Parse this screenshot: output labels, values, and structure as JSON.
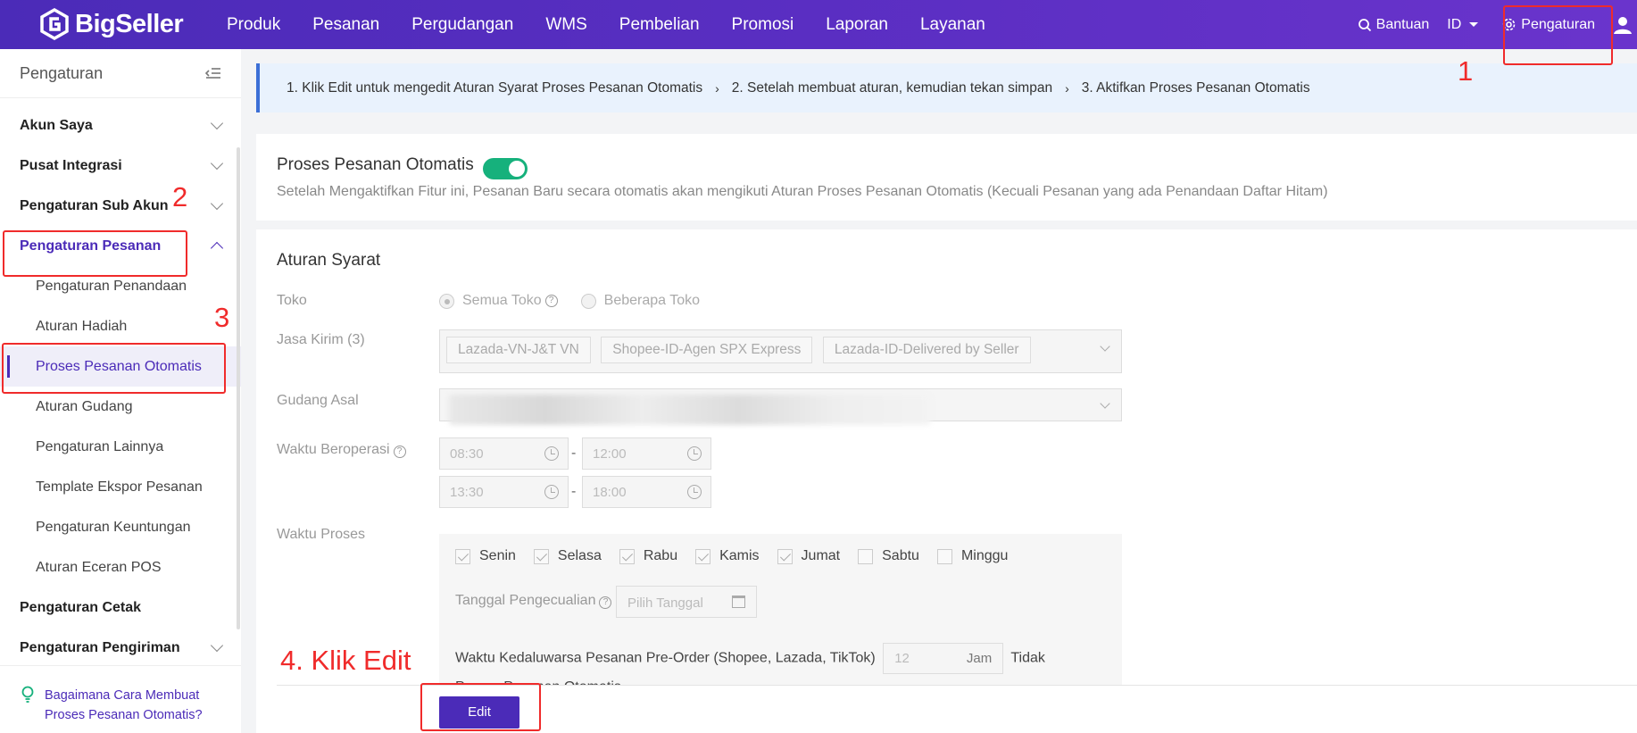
{
  "app": {
    "name": "BigSeller"
  },
  "nav": [
    "Produk",
    "Pesanan",
    "Pergudangan",
    "WMS",
    "Pembelian",
    "Promosi",
    "Laporan",
    "Layanan"
  ],
  "top_right": {
    "help": "Bantuan",
    "lang": "ID",
    "settings": "Pengaturan"
  },
  "sidebar": {
    "title": "Pengaturan",
    "groups": {
      "akun": "Akun Saya",
      "integrasi": "Pusat Integrasi",
      "sub_akun": "Pengaturan Sub Akun",
      "pesanan": "Pengaturan Pesanan",
      "cetak": "Pengaturan Cetak",
      "pengiriman": "Pengaturan Pengiriman"
    },
    "sub_items": [
      "Pengaturan Penandaan",
      "Aturan Hadiah",
      "Proses Pesanan Otomatis",
      "Aturan Gudang",
      "Pengaturan Lainnya",
      "Template Ekspor Pesanan",
      "Pengaturan Keuntungan",
      "Aturan Eceran POS"
    ],
    "help_link": "Bagaimana Cara Membuat Proses Pesanan Otomatis?"
  },
  "banner": {
    "step1": "1. Klik Edit untuk mengedit Aturan Syarat Proses Pesanan Otomatis",
    "step2": "2. Setelah membuat aturan, kemudian tekan simpan",
    "step3": "3. Aktifkan Proses Pesanan Otomatis"
  },
  "auto_process": {
    "title": "Proses Pesanan Otomatis",
    "enabled": true,
    "description": "Setelah Mengaktifkan Fitur ini, Pesanan Baru secara otomatis akan mengikuti Aturan Proses Pesanan Otomatis (Kecuali Pesanan yang ada Penandaan Daftar Hitam)"
  },
  "rules": {
    "title": "Aturan Syarat",
    "toko_label": "Toko",
    "toko_options": [
      "Semua Toko",
      "Beberapa Toko"
    ],
    "toko_selected": "Semua Toko",
    "jasa_label": "Jasa Kirim (3)",
    "jasa_tags": [
      "Lazada-VN-J&T VN",
      "Shopee-ID-Agen SPX Express",
      "Lazada-ID-Delivered by Seller"
    ],
    "gudang_label": "Gudang Asal",
    "waktu_label": "Waktu Beroperasi",
    "times": [
      [
        "08:30",
        "12:00"
      ],
      [
        "13:30",
        "18:00"
      ]
    ],
    "proses_label": "Waktu Proses",
    "days": [
      {
        "label": "Senin",
        "checked": true
      },
      {
        "label": "Selasa",
        "checked": true
      },
      {
        "label": "Rabu",
        "checked": true
      },
      {
        "label": "Kamis",
        "checked": true
      },
      {
        "label": "Jumat",
        "checked": true
      },
      {
        "label": "Sabtu",
        "checked": false
      },
      {
        "label": "Minggu",
        "checked": false
      }
    ],
    "exception_label": "Tanggal Pengecualian",
    "date_placeholder": "Pilih Tanggal",
    "preorder_prefix": "Waktu Kedaluwarsa Pesanan Pre-Order (Shopee, Lazada, TikTok)",
    "preorder_value": "12",
    "preorder_unit": "Jam",
    "preorder_suffix": "Tidak Proses Pesanan Otomatis",
    "edit_button": "Edit"
  },
  "annotations": {
    "n1": "1",
    "n2": "2",
    "n3": "3",
    "n4": "4. Klik Edit"
  },
  "colors": {
    "brand": "#4b2bb8",
    "toggle": "#16b17c",
    "annotation": "#f02b2b"
  }
}
